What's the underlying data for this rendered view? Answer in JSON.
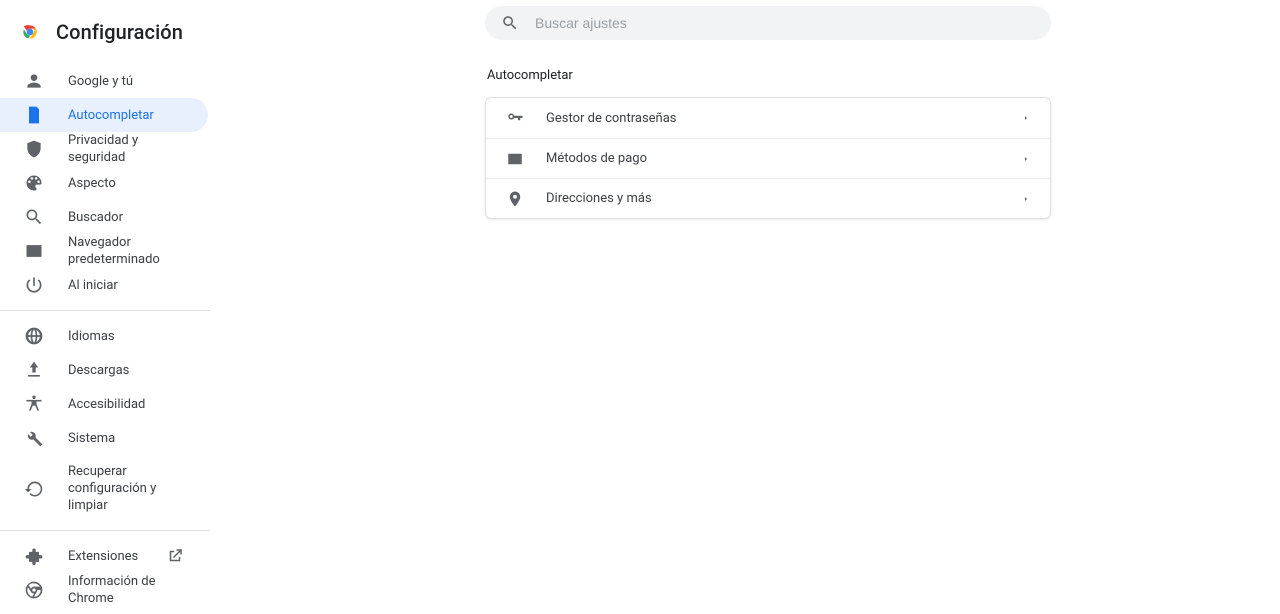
{
  "app": {
    "title": "Configuración"
  },
  "search": {
    "placeholder": "Buscar ajustes"
  },
  "sidebar": {
    "items": [
      {
        "label": "Google y tú"
      },
      {
        "label": "Autocompletar"
      },
      {
        "label": "Privacidad y seguridad"
      },
      {
        "label": "Aspecto"
      },
      {
        "label": "Buscador"
      },
      {
        "label": "Navegador predeterminado"
      },
      {
        "label": "Al iniciar"
      }
    ],
    "advanced": [
      {
        "label": "Idiomas"
      },
      {
        "label": "Descargas"
      },
      {
        "label": "Accesibilidad"
      },
      {
        "label": "Sistema"
      },
      {
        "label": "Recuperar configuración y limpiar"
      }
    ],
    "footer": [
      {
        "label": "Extensiones"
      },
      {
        "label": "Información de Chrome"
      }
    ]
  },
  "main": {
    "section_title": "Autocompletar",
    "rows": [
      {
        "label": "Gestor de contraseñas"
      },
      {
        "label": "Métodos de pago"
      },
      {
        "label": "Direcciones y más"
      }
    ]
  }
}
